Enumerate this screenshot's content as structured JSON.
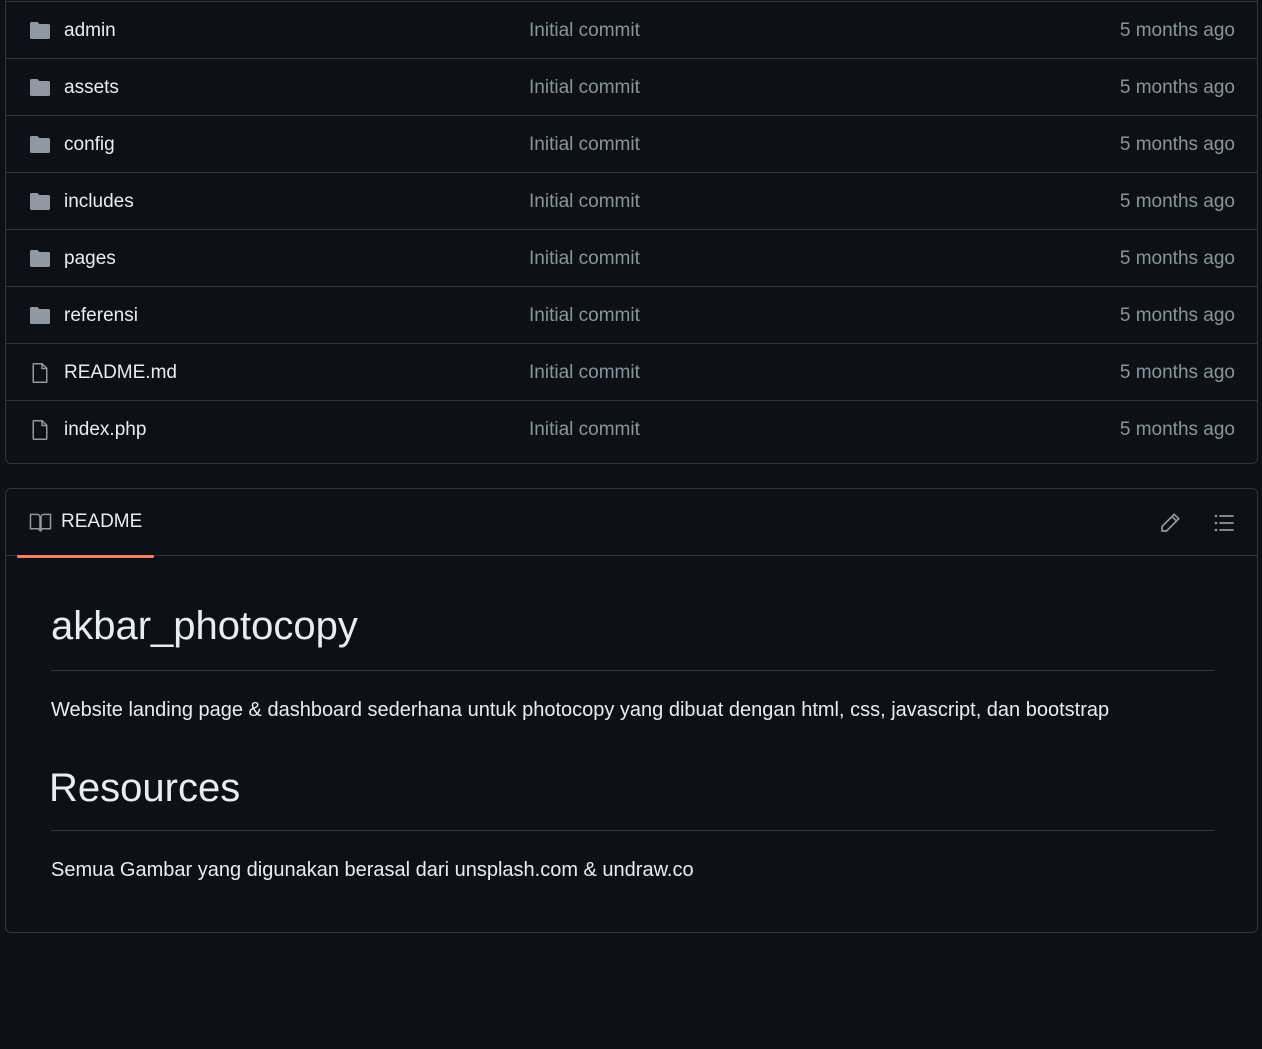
{
  "files": [
    {
      "type": "folder",
      "name": "admin",
      "message": "Initial commit",
      "time": "5 months ago"
    },
    {
      "type": "folder",
      "name": "assets",
      "message": "Initial commit",
      "time": "5 months ago"
    },
    {
      "type": "folder",
      "name": "config",
      "message": "Initial commit",
      "time": "5 months ago"
    },
    {
      "type": "folder",
      "name": "includes",
      "message": "Initial commit",
      "time": "5 months ago"
    },
    {
      "type": "folder",
      "name": "pages",
      "message": "Initial commit",
      "time": "5 months ago"
    },
    {
      "type": "folder",
      "name": "referensi",
      "message": "Initial commit",
      "time": "5 months ago"
    },
    {
      "type": "file",
      "name": "README.md",
      "message": "Initial commit",
      "time": "5 months ago"
    },
    {
      "type": "file",
      "name": "index.php",
      "message": "Initial commit",
      "time": "5 months ago"
    }
  ],
  "readme": {
    "tab_label": "README",
    "tab_icon": "book-icon",
    "edit_icon": "pencil-icon",
    "outline_icon": "list-icon",
    "accent_color": "#f78166",
    "title": "akbar_photocopy",
    "description": "Website landing page & dashboard sederhana untuk photocopy yang dibuat dengan html, css, javascript, dan bootstrap",
    "resources_heading": "Resources",
    "resources_text": "Semua Gambar yang digunakan berasal dari unsplash.com & undraw.co"
  },
  "colors": {
    "background": "#0d1117",
    "border": "#30363d",
    "text": "#e6edf3",
    "muted": "#8b949e",
    "icon": "#9198a1"
  }
}
